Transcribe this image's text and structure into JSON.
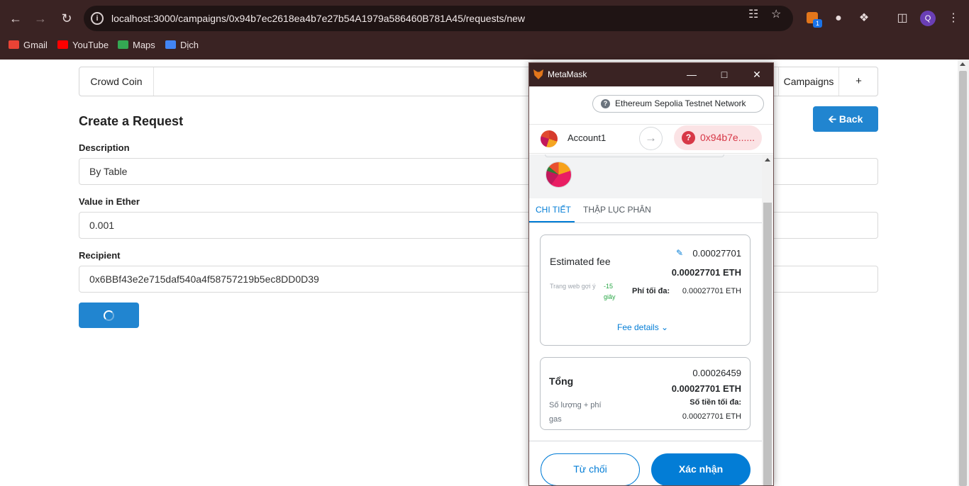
{
  "browser": {
    "url": "localhost:3000/campaigns/0x94b7ec2618ea4b7e27b54A1979a586460B781A45/requests/new",
    "profile_initial": "Q",
    "extension_badge": "1",
    "bookmarks": [
      {
        "label": "Gmail",
        "icon": "gmail-icon",
        "color": "#ea4335"
      },
      {
        "label": "YouTube",
        "icon": "youtube-icon",
        "color": "#ff0000"
      },
      {
        "label": "Maps",
        "icon": "maps-icon",
        "color": "#34a853"
      },
      {
        "label": "Dịch",
        "icon": "translate-icon",
        "color": "#4285f4"
      }
    ]
  },
  "page": {
    "brand": "Crowd Coin",
    "nav_campaigns": "Campaigns",
    "nav_plus": "+",
    "title": "Create a Request",
    "back_label": "Back",
    "accent": "#2185d0",
    "fields": {
      "description_label": "Description",
      "description_value": "By Table",
      "value_label": "Value in Ether",
      "value_value": "0.001",
      "recipient_label": "Recipient",
      "recipient_value": "0x6BBf43e2e715daf540a4f58757219b5ec8DD0D39"
    },
    "submit_loading": true
  },
  "metamask": {
    "window_title": "MetaMask",
    "network": "Ethereum Sepolia Testnet Network",
    "account_name": "Account1",
    "recipient_short": "0x94b7e......",
    "tabs": [
      "CHI TIẾT",
      "THẬP LỤC PHÂN"
    ],
    "active_tab": "CHI TIẾT",
    "fee": {
      "label": "Estimated fee",
      "edit_value": "0.00027701",
      "value_eth": "0.00027701 ETH",
      "site_suggested": "Trang web gợi ý",
      "time": "-15 giây",
      "max_fee_label": "Phí tối đa:",
      "max_fee_value": "0.00027701 ETH",
      "details_link": "Fee details"
    },
    "total": {
      "label": "Tổng",
      "value_top": "0.00026459",
      "value_eth": "0.00027701 ETH",
      "amount_gas": "Số lượng + phí gas",
      "max_amount_label": "Số tiền tối đa:",
      "max_amount_value": "0.00027701 ETH"
    },
    "reject_label": "Từ chối",
    "confirm_label": "Xác nhận",
    "accent": "#037dd6"
  }
}
